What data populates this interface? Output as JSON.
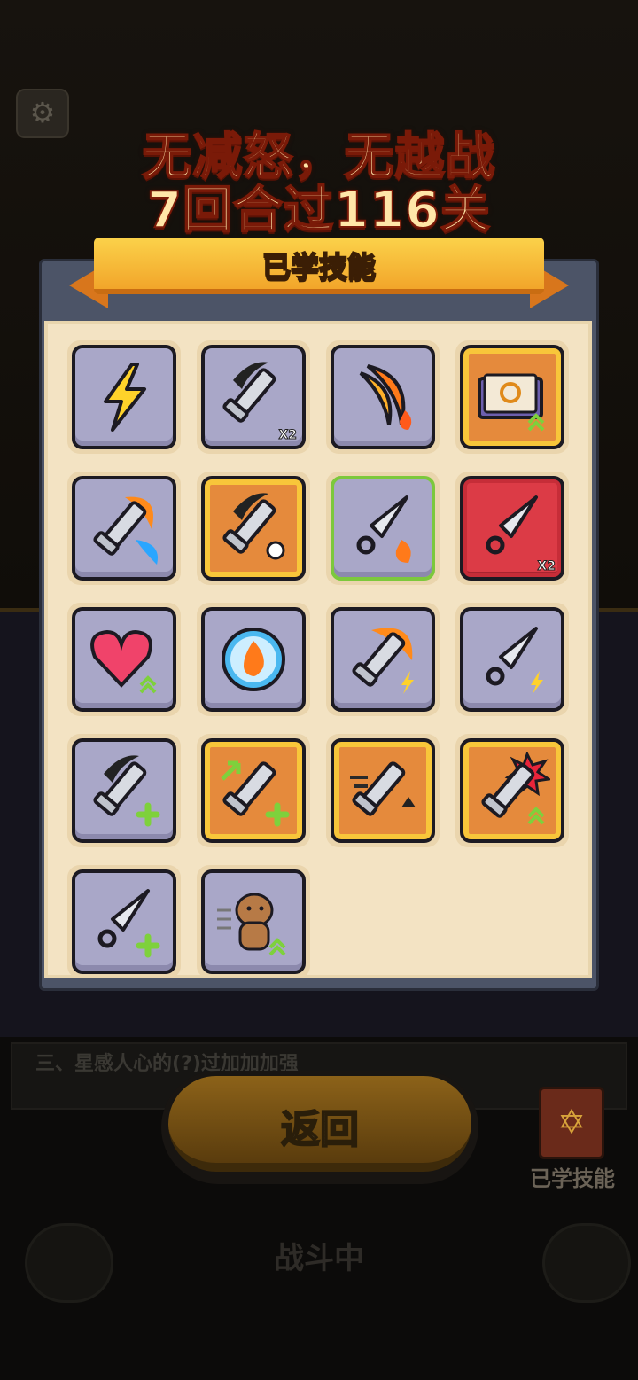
{
  "overlay_title": {
    "line1": "无减怒，无越战",
    "line2": "7回合过116关"
  },
  "panel": {
    "title": "已学技能"
  },
  "skills": [
    {
      "name": "lightning-skill",
      "frame": "gray",
      "badge": ""
    },
    {
      "name": "double-slash-skill",
      "frame": "gray",
      "badge": "X2"
    },
    {
      "name": "fire-crescent-skill",
      "frame": "gray",
      "badge": ""
    },
    {
      "name": "spellbook-upgrade-skill",
      "frame": "orange",
      "badge": ""
    },
    {
      "name": "fire-ice-sword-skill",
      "frame": "gray",
      "badge": ""
    },
    {
      "name": "reaper-sword-skill",
      "frame": "orange",
      "badge": ""
    },
    {
      "name": "fire-kunai-skill",
      "frame": "gray",
      "badge": ""
    },
    {
      "name": "double-kunai-skill",
      "frame": "red",
      "badge": "X2"
    },
    {
      "name": "heart-upgrade-skill",
      "frame": "gray",
      "badge": ""
    },
    {
      "name": "fire-orb-skill",
      "frame": "gray",
      "badge": ""
    },
    {
      "name": "flame-lightning-sword-skill",
      "frame": "gray",
      "badge": ""
    },
    {
      "name": "lightning-kunai-skill",
      "frame": "gray",
      "badge": ""
    },
    {
      "name": "slash-plus-skill",
      "frame": "gray",
      "badge": ""
    },
    {
      "name": "growth-sword-skill",
      "frame": "orange",
      "badge": ""
    },
    {
      "name": "dash-sword-skill",
      "frame": "orange",
      "badge": ""
    },
    {
      "name": "critical-sword-skill",
      "frame": "orange",
      "badge": ""
    },
    {
      "name": "kunai-plus-skill",
      "frame": "gray",
      "badge": ""
    },
    {
      "name": "capybara-speed-skill",
      "frame": "gray",
      "badge": ""
    }
  ],
  "hint": "三、星感人心的(?)过加加加强",
  "back_button": "返回",
  "learned_skills_label": "已学技能",
  "battle_label": "战斗中",
  "colors": {
    "gray_frame": "#a9a7c8",
    "orange_frame": "#e58a3c",
    "red_frame": "#dc3b46",
    "ribbon": "#f6b53a"
  }
}
